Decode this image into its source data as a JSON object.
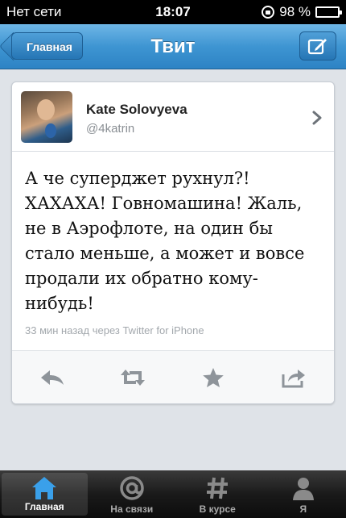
{
  "status_bar": {
    "carrier": "Нет сети",
    "time": "18:07",
    "battery": "98 %"
  },
  "nav": {
    "back_label": "Главная",
    "title": "Твит",
    "compose_icon": "compose-icon"
  },
  "tweet": {
    "user_name": "Kate Solovyeva",
    "user_handle": "@4katrin",
    "text": "А че суперджет рухнул?! ХАХАХА! Говномашина! Жаль, не в Аэрофлоте, на один бы стало меньше, а может и вовсе продали их обратно кому-нибудь!",
    "meta": "33 мин назад через Twitter for iPhone"
  },
  "actions": [
    {
      "icon": "reply-icon"
    },
    {
      "icon": "retweet-icon"
    },
    {
      "icon": "favorite-star-icon"
    },
    {
      "icon": "share-icon"
    }
  ],
  "tabs": [
    {
      "label": "Главная",
      "icon": "home-icon",
      "active": true
    },
    {
      "label": "На связи",
      "icon": "at-icon",
      "active": false
    },
    {
      "label": "В курсе",
      "icon": "hashtag-icon",
      "active": false
    },
    {
      "label": "Я",
      "icon": "person-icon",
      "active": false
    }
  ],
  "colors": {
    "nav_blue": "#3e95d2",
    "tab_active_blue": "#2f8fd6"
  }
}
